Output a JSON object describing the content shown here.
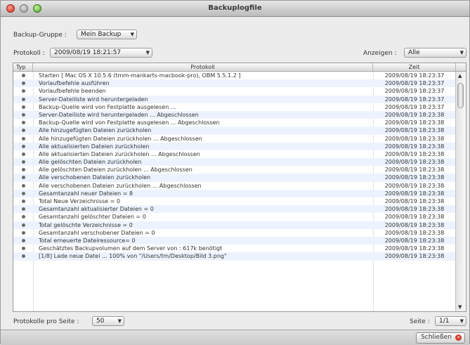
{
  "window": {
    "title": "Backuplogfile"
  },
  "backup_group": {
    "label": "Backup-Gruppe :",
    "value": "Mein Backup"
  },
  "protocol": {
    "label": "Protokoll :",
    "value": "2009/08/19 18:21:57"
  },
  "filter": {
    "label": "Anzeigen :",
    "value": "Alle"
  },
  "table": {
    "headers": {
      "type": "Typ",
      "protocol": "Protokoll",
      "time": "Zeit"
    },
    "rows": [
      {
        "msg": "Starten [ Mac OS X 10.5.6 (tmm-mankarts-macbook-pro), OBM 5.5.1.2 ]",
        "time": "2009/08/19 18:23:37"
      },
      {
        "msg": "Vorlaufbefehle ausführen",
        "time": "2009/08/19 18:23:37"
      },
      {
        "msg": "Vorlaufbefehle beenden",
        "time": "2009/08/19 18:23:37"
      },
      {
        "msg": "Server-Dateiliste wird heruntergeladen",
        "time": "2009/08/19 18:23:37"
      },
      {
        "msg": "Backup-Quelle wird von Festplatte ausgelesen ...",
        "time": "2009/08/19 18:23:37"
      },
      {
        "msg": "Server-Dateiliste wird heruntergeladen ... Abgeschlossen",
        "time": "2009/08/19 18:23:38"
      },
      {
        "msg": "Backup-Quelle wird von Festplatte ausgelesen ... Abgeschlossen",
        "time": "2009/08/19 18:23:38"
      },
      {
        "msg": "Alle hinzugefügten Dateien zurückholen",
        "time": "2009/08/19 18:23:38"
      },
      {
        "msg": "Alle hinzugefügten Dateien zurückholen ... Abgeschlossen",
        "time": "2009/08/19 18:23:38"
      },
      {
        "msg": "Alle aktualisierten Dateien zurückholen",
        "time": "2009/08/19 18:23:38"
      },
      {
        "msg": "Alle aktualisierten Dateien zurückholen ... Abgeschlossen",
        "time": "2009/08/19 18:23:38"
      },
      {
        "msg": "Alle gelöschten Dateien zurückholen",
        "time": "2009/08/19 18:23:38"
      },
      {
        "msg": "Alle gelöschten Dateien zurückholen ... Abgeschlossen",
        "time": "2009/08/19 18:23:38"
      },
      {
        "msg": "Alle verschobenen Dateien zurückholen",
        "time": "2009/08/19 18:23:38"
      },
      {
        "msg": "Alle verschobenen Dateien zurückholen ... Abgeschlossen",
        "time": "2009/08/19 18:23:38"
      },
      {
        "msg": "Gesamtanzahl neuer Dateien = 8",
        "time": "2009/08/19 18:23:38"
      },
      {
        "msg": "Total Neue Verzeichnisse = 0",
        "time": "2009/08/19 18:23:38"
      },
      {
        "msg": "Gesamtanzahl aktualisierter Dateien = 0",
        "time": "2009/08/19 18:23:38"
      },
      {
        "msg": "Gesamtanzahl gelöschter Dateien = 0",
        "time": "2009/08/19 18:23:38"
      },
      {
        "msg": "Total gelöschte Verzeichnisse = 0",
        "time": "2009/08/19 18:23:38"
      },
      {
        "msg": "Gesamtanzahl verschobener Dateien = 0",
        "time": "2009/08/19 18:23:38"
      },
      {
        "msg": "Total erneuerte Dateiressource= 0",
        "time": "2009/08/19 18:23:38"
      },
      {
        "msg": "Geschätztes Backupvolumen auf dem Server von : 617k benötigt",
        "time": "2009/08/19 18:23:38"
      },
      {
        "msg": "[1/8] Lade neue Datei ... 100% von \"/Users/tm/Desktop/Bild 3.png\"",
        "time": "2009/08/19 18:23:38"
      }
    ]
  },
  "pagination": {
    "per_page_label": "Protokolle pro Seite :",
    "per_page_value": "50",
    "page_label": "Seite :",
    "page_value": "1/1"
  },
  "footer": {
    "close_label": "Schließen"
  },
  "icons": {
    "type_icon": "info-bullet-icon",
    "dropdown": "chevron-down-icon",
    "close": "close-x-icon"
  }
}
